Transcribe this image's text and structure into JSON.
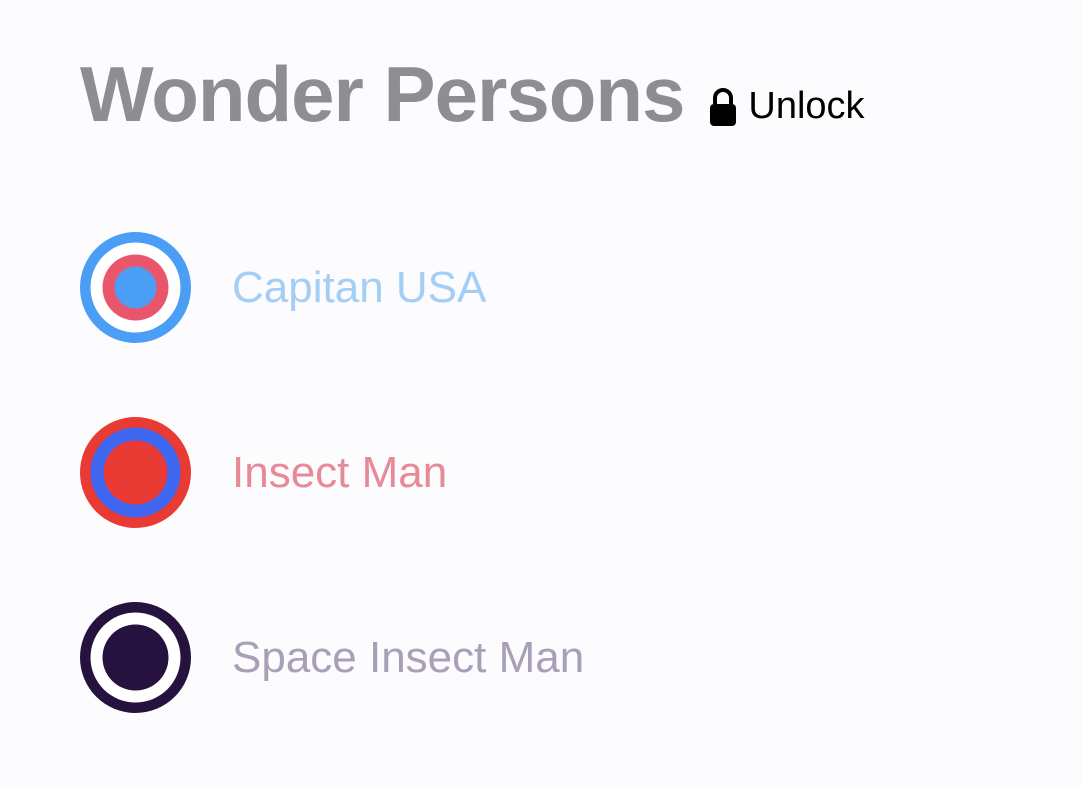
{
  "header": {
    "title": "Wonder Persons",
    "unlock_label": "Unlock",
    "lock_icon": "lock-icon"
  },
  "persons": [
    {
      "name": "Capitan USA",
      "name_color": "#a3cef6",
      "icon": "shield-target-icon",
      "rings": [
        "#4a9ef5",
        "#ffffff",
        "#e9566b",
        "#4a9ef5"
      ]
    },
    {
      "name": "Insect Man",
      "name_color": "#e78a97",
      "icon": "web-target-icon",
      "rings": [
        "#e93a33",
        "#3f66f0",
        "#e93a33"
      ]
    },
    {
      "name": "Space Insect Man",
      "name_color": "#a9a0b8",
      "icon": "dark-target-icon",
      "rings": [
        "#26123f",
        "#ffffff",
        "#26123f"
      ]
    }
  ]
}
